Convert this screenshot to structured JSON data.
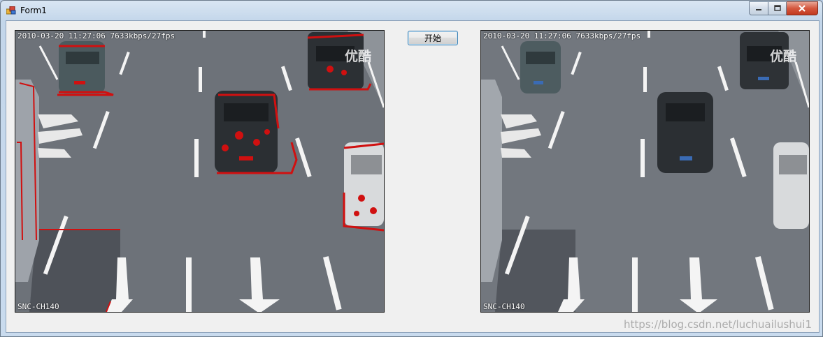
{
  "window": {
    "title": "Form1"
  },
  "controls": {
    "start_label": "开始"
  },
  "videos": [
    {
      "timestamp": "2010-03-20 11:27:06 7633kbps/27fps",
      "camera": "SNC-CH140",
      "logo": "优酷"
    },
    {
      "timestamp": "2010-03-20 11:27:06 7633kbps/27fps",
      "camera": "SNC-CH140",
      "logo": "优酷"
    }
  ],
  "footer": {
    "watermark": "https://blog.csdn.net/luchuailushui1"
  },
  "colors": {
    "detection": "#d01010",
    "road": "#6c7178",
    "button_border": "#3c7fb1"
  }
}
